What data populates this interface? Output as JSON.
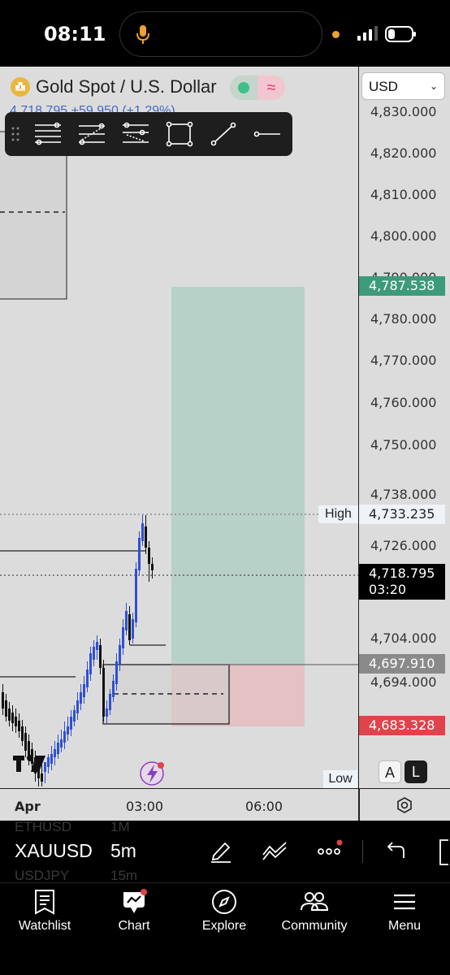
{
  "status_bar": {
    "time": "08:11"
  },
  "header": {
    "symbol_name": "Gold Spot / U.S. Dollar",
    "sub_price": "4,718.795  +59.950 (+1.29%)",
    "currency": "USD"
  },
  "price_axis": {
    "labels": [
      "4,830.000",
      "4,820.000",
      "4,810.000",
      "4,800.000",
      "4,790.000",
      "4,780.000",
      "4,770.000",
      "4,760.000",
      "4,750.000",
      "4,738.000",
      "4,726.000",
      "4,704.000",
      "4,694.000"
    ],
    "target_price": "4,787.538",
    "high_price": "4,733.235",
    "current_price": "4,718.795",
    "countdown": "03:20",
    "entry_price": "4,697.910",
    "stop_price": "4,683.328",
    "colors": {
      "target": "#3d9a7a",
      "current": "#000000",
      "entry": "#8a8a8a",
      "stop": "#e0434b"
    }
  },
  "chart": {
    "high_label": "High",
    "low_label": "Low",
    "auto_label": "A",
    "log_label": "L",
    "colors": {
      "up_candle": "#2f4fd6",
      "down_candle": "#111111",
      "profit_zone": "#b7d1c9",
      "loss_zone": "#e3c1c4"
    }
  },
  "time_axis": {
    "labels": [
      "Apr",
      "03:00",
      "06:00"
    ]
  },
  "symbol_row": {
    "ghost_above_symbol": "ETHUSD",
    "ghost_above_interval": "1M",
    "symbol": "XAUUSD",
    "interval": "5m",
    "ghost_below_symbol": "USDJPY",
    "ghost_below_interval": "15m"
  },
  "bottom_nav": {
    "items": [
      {
        "label": "Watchlist",
        "icon": "watchlist-icon"
      },
      {
        "label": "Chart",
        "icon": "chart-icon"
      },
      {
        "label": "Explore",
        "icon": "compass-icon"
      },
      {
        "label": "Community",
        "icon": "community-icon"
      },
      {
        "label": "Menu",
        "icon": "menu-icon"
      }
    ]
  }
}
